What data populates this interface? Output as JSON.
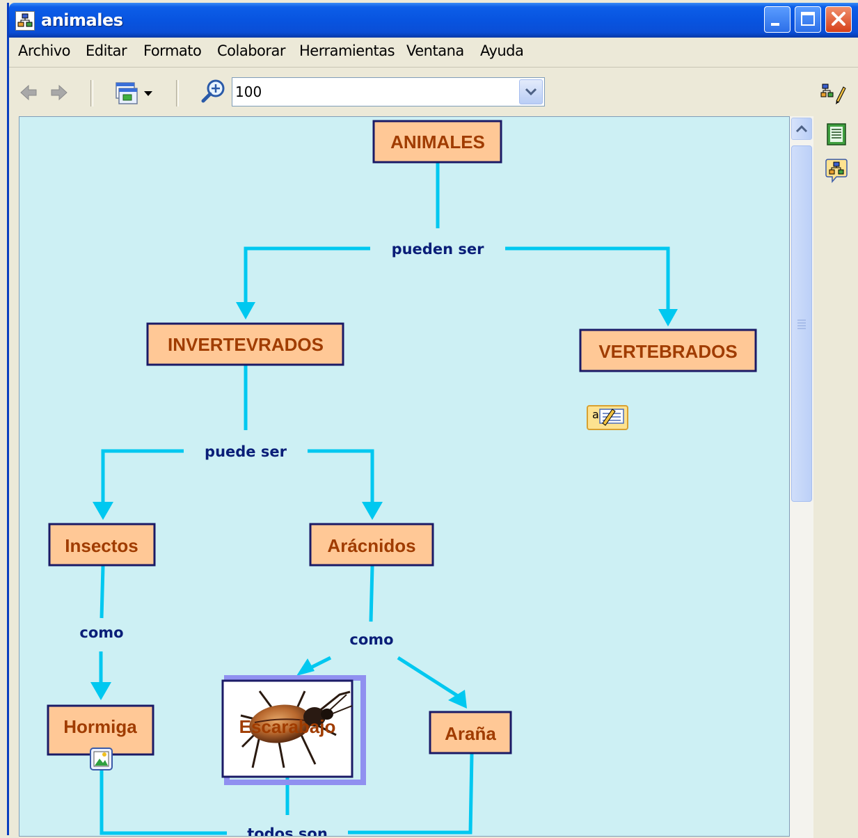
{
  "window": {
    "title": "animales",
    "controls": [
      "minimize",
      "maximize",
      "close"
    ]
  },
  "menu": {
    "items": [
      "Archivo",
      "Editar",
      "Formato",
      "Colaborar",
      "Herramientas",
      "Ventana",
      "Ayuda"
    ]
  },
  "toolbar": {
    "back_icon": "arrow-left-icon",
    "forward_icon": "arrow-right-icon",
    "view_icon": "view-window-icon",
    "zoom_icon": "zoom-in-icon",
    "zoom_value": "100",
    "style_icon": "style-palette-icon"
  },
  "right_rail": {
    "icons": [
      "list-document-icon",
      "concept-map-chat-icon"
    ]
  },
  "concept_map": {
    "concepts": {
      "animales": "ANIMALES",
      "invertebrados": "INVERTEVRADOS",
      "vertebrados": "VERTEBRADOS",
      "insectos": "Insectos",
      "aracnidos": "Arácnidos",
      "hormiga": "Hormiga",
      "escarabajo": "Escarabajo",
      "arana": "Araña"
    },
    "linking_phrases": {
      "pueden_ser": "pueden ser",
      "puede_ser": "puede ser",
      "como_1": "como",
      "como_2": "como",
      "todos_son": "todos son"
    },
    "annotation_icon": "annotation-note-icon",
    "resource_icon": "image-resource-icon"
  },
  "colors": {
    "canvas_bg": "#cdf0f4",
    "concept_fill": "#ffc896",
    "concept_border": "#1a1a66",
    "concept_text": "#a03c00",
    "link_line": "#00c8f0",
    "linking_text": "#0a1e78",
    "titlebar": "#0a54e0"
  }
}
